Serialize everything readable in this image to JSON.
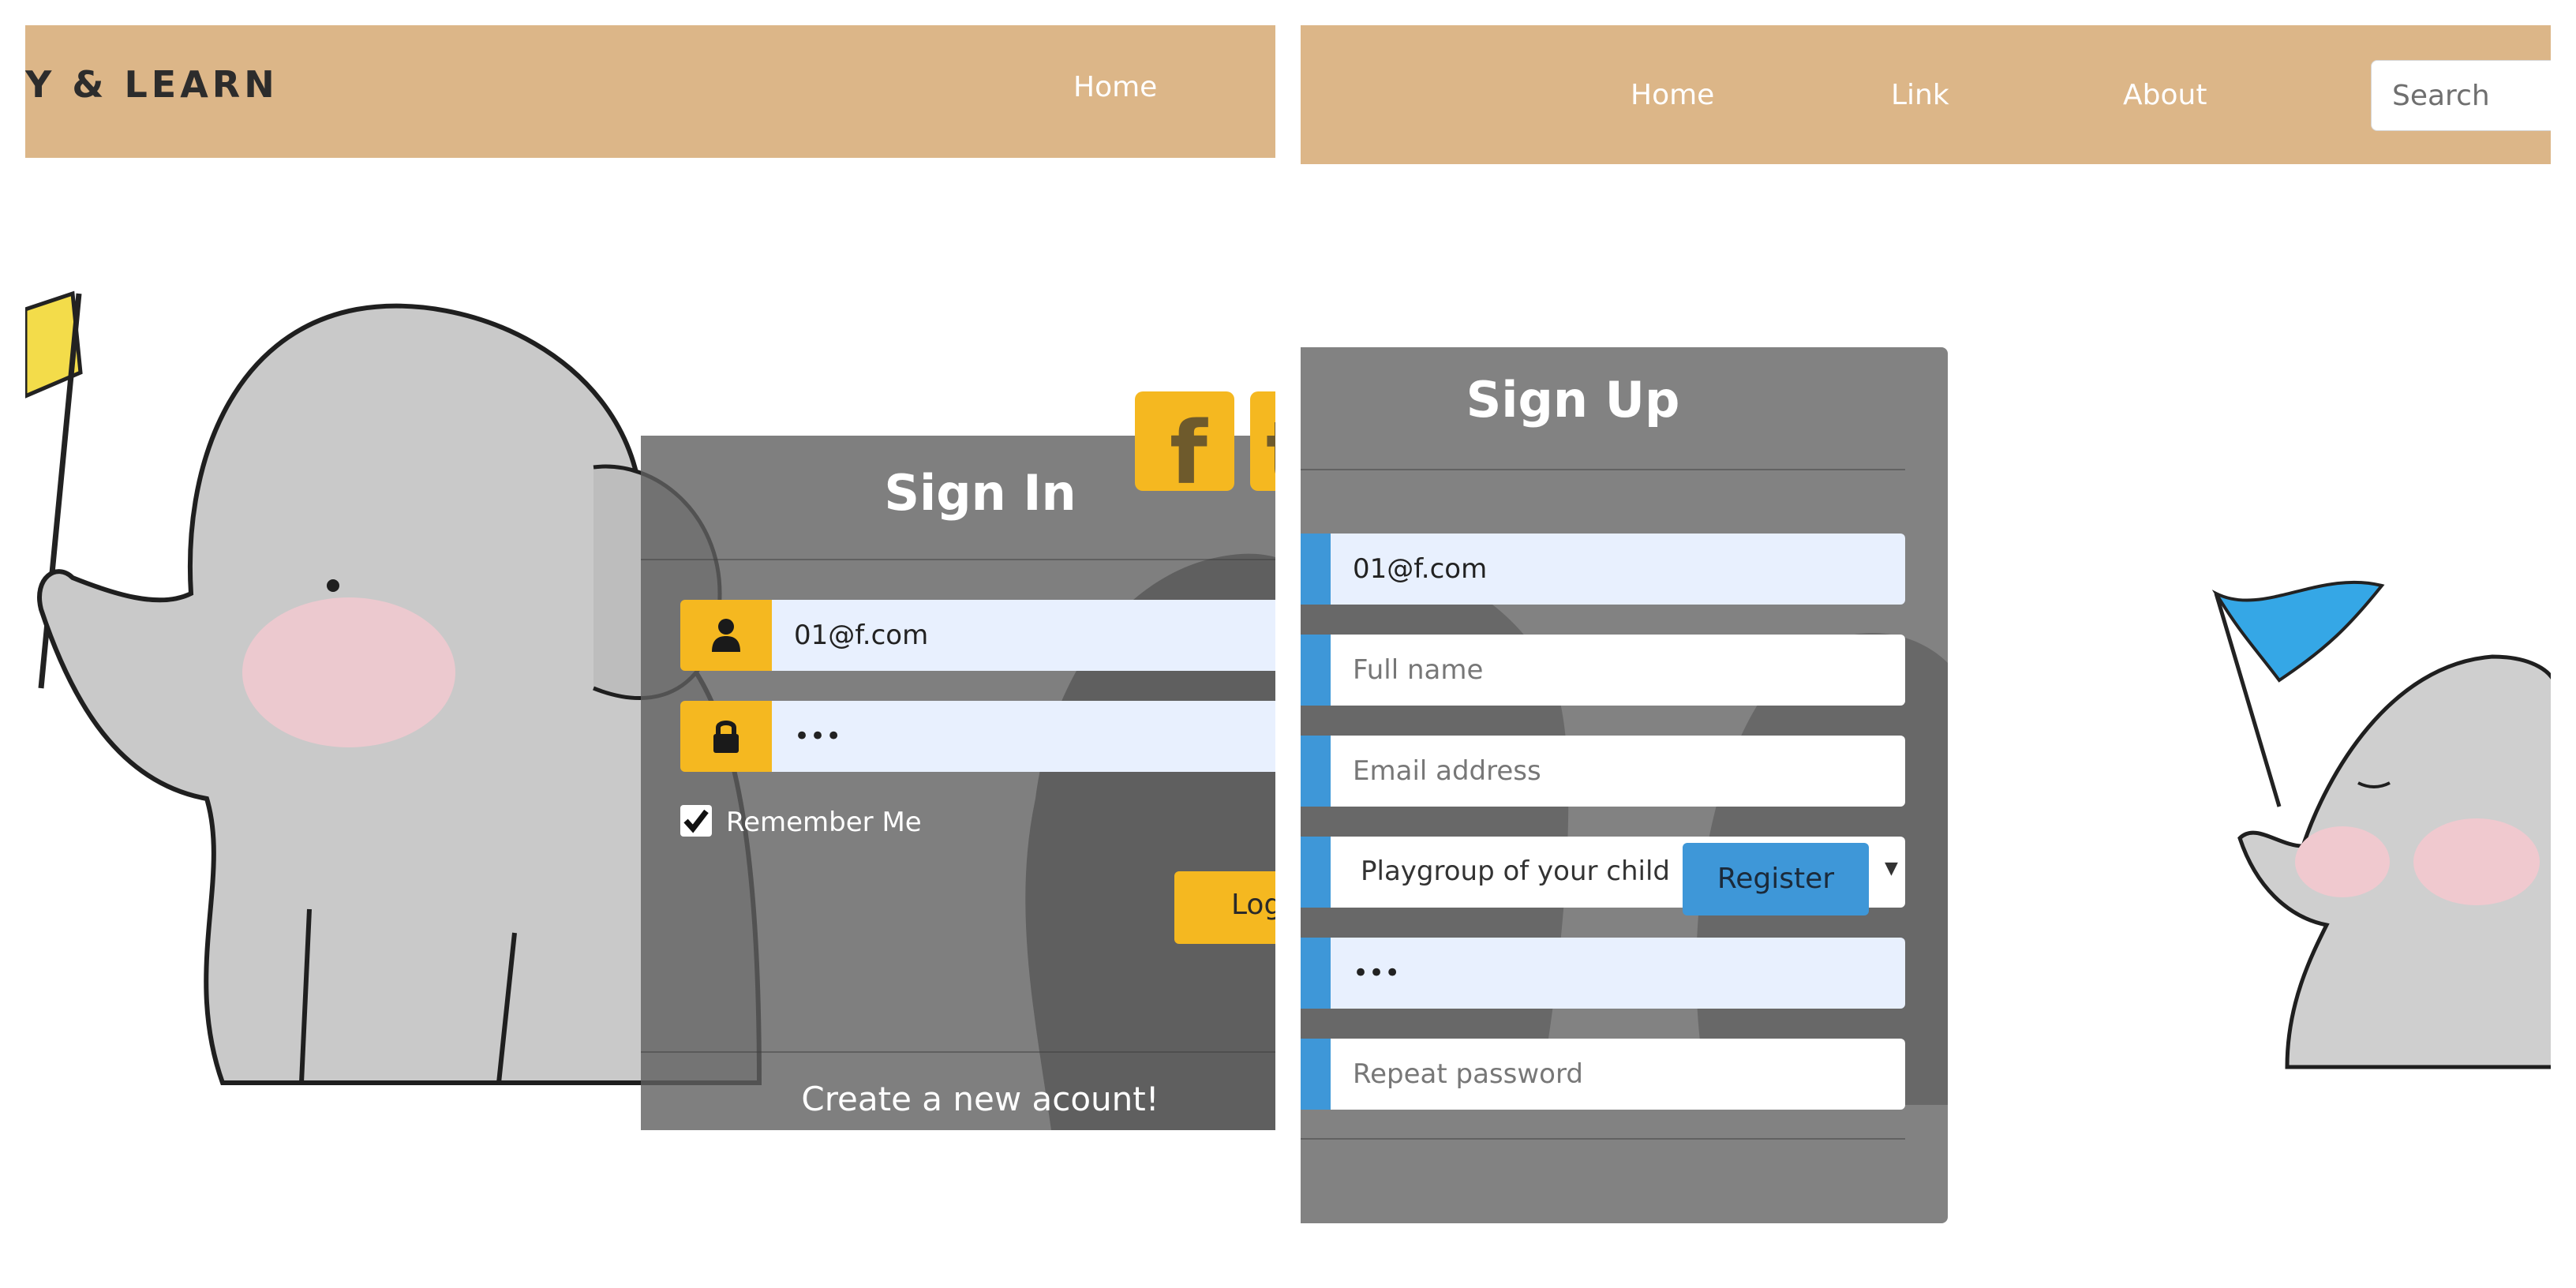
{
  "left_screen": {
    "brand": "Y & LEARN",
    "nav": {
      "home": "Home"
    },
    "signin": {
      "title": "Sign In",
      "email_value": "01@f.com",
      "password_value": "•••",
      "remember_label": "Remember Me",
      "remember_checked": true,
      "login_label": "Logi",
      "create_account_link": "Create a new acount!"
    },
    "social": {
      "facebook_glyph": "f",
      "twitter_glyph": "t"
    }
  },
  "right_screen": {
    "nav": {
      "home": "Home",
      "link": "Link",
      "about": "About"
    },
    "search": {
      "placeholder": "Search"
    },
    "signup": {
      "title": "Sign Up",
      "email_value": "01@f.com",
      "fullname_placeholder": "Full name",
      "email_placeholder": "Email address",
      "playgroup_selected": "Playgroup of your child",
      "password_value": "•••",
      "repeat_password_placeholder": "Repeat password",
      "register_label": "Register"
    }
  },
  "colors": {
    "navbar": "#dcb688",
    "signin_accent": "#f5b820",
    "signup_accent": "#3e97d8",
    "card_overlay": "#5f5f5f",
    "autofill_field": "#e8f0fe",
    "flag_left": "#f3dc4a",
    "flag_right": "#35a7e6"
  },
  "icons": [
    "user-icon",
    "lock-icon",
    "facebook-icon",
    "twitter-icon",
    "checkmark-icon",
    "dropdown-caret-icon"
  ]
}
